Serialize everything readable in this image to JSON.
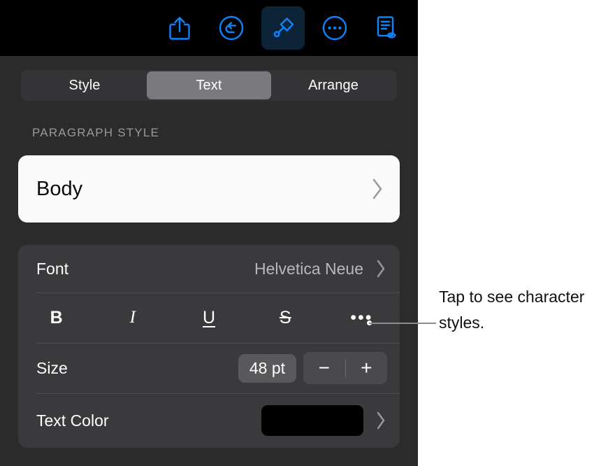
{
  "toolbar": {
    "buttons": [
      {
        "name": "share-icon",
        "label": "Share"
      },
      {
        "name": "undo-icon",
        "label": "Undo"
      },
      {
        "name": "format-brush-icon",
        "label": "Format",
        "selected": true
      },
      {
        "name": "more-options-icon",
        "label": "More"
      },
      {
        "name": "document-view-icon",
        "label": "Document Options"
      }
    ]
  },
  "segmented_control": {
    "options": [
      {
        "label": "Style",
        "selected": false
      },
      {
        "label": "Text",
        "selected": true
      },
      {
        "label": "Arrange",
        "selected": false
      }
    ]
  },
  "paragraph_style": {
    "header": "PARAGRAPH STYLE",
    "value": "Body"
  },
  "font_row": {
    "label": "Font",
    "value": "Helvetica Neue"
  },
  "format_row": {
    "bold": "B",
    "italic": "I",
    "underline": "U",
    "strikethrough": "S",
    "more": "•••"
  },
  "size_row": {
    "label": "Size",
    "value": "48 pt",
    "decrement": "−",
    "increment": "+"
  },
  "color_row": {
    "label": "Text Color",
    "swatch_color": "#000000"
  },
  "callout": {
    "text": "Tap to see character styles."
  },
  "colors": {
    "accent": "#0a84ff",
    "toolbar_bg": "#000000",
    "panel_bg": "#2b2b2b",
    "card_bg": "#3a3a3c",
    "selected_segment": "#7a7a7e"
  }
}
